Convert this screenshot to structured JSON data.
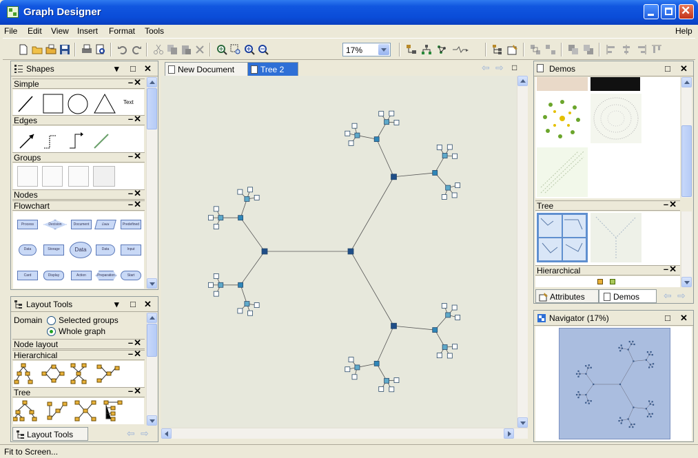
{
  "window": {
    "title": "Graph Designer"
  },
  "menu": {
    "items": [
      "File",
      "Edit",
      "View",
      "Insert",
      "Format",
      "Tools"
    ],
    "help": "Help"
  },
  "toolbar": {
    "zoom_value": "17%",
    "icons": [
      "new-document-icon",
      "open-folder-icon",
      "open-icon",
      "save-icon",
      "print-icon",
      "print-preview-icon",
      "undo-icon",
      "redo-icon",
      "cut-icon",
      "copy-icon",
      "paste-icon",
      "delete-icon",
      "zoom-area-icon",
      "zoom-fit-icon",
      "zoom-in-icon",
      "zoom-out-icon"
    ]
  },
  "shapes_panel": {
    "title": "Shapes",
    "sections": {
      "simple": "Simple",
      "edges": "Edges",
      "groups": "Groups",
      "nodes": "Nodes",
      "flowchart": "Flowchart"
    },
    "simple_text": "Text",
    "flowchart_labels": [
      "Process",
      "Decision",
      "Document",
      "Data",
      "Predefined",
      "Data",
      "Storage",
      "Data",
      "Data",
      "Input",
      "Card",
      "Display",
      "Action",
      "Preparation",
      "Start"
    ]
  },
  "layout_panel": {
    "title": "Layout Tools",
    "domain_label": "Domain",
    "option_selected": "Selected groups",
    "option_whole": "Whole graph",
    "sections": {
      "node_layout": "Node layout",
      "hierarchical": "Hierarchical",
      "tree": "Tree"
    },
    "bottom_tab": "Layout Tools"
  },
  "documents": {
    "tabs": [
      "New Document",
      "Tree 2"
    ],
    "active": "Tree 2"
  },
  "demos_panel": {
    "title": "Demos",
    "sections": {
      "tree": "Tree",
      "hierarchical": "Hierarchical"
    },
    "tabs": [
      "Attributes",
      "Demos"
    ]
  },
  "navigator": {
    "title": "Navigator (17%)"
  },
  "status": {
    "text": "Fit to Screen..."
  },
  "colors": {
    "accent": "#2e6fd6",
    "node_fill": "#5fa9c9",
    "hub_fill": "#1f4e88",
    "canvas": "#e7e8dc"
  }
}
